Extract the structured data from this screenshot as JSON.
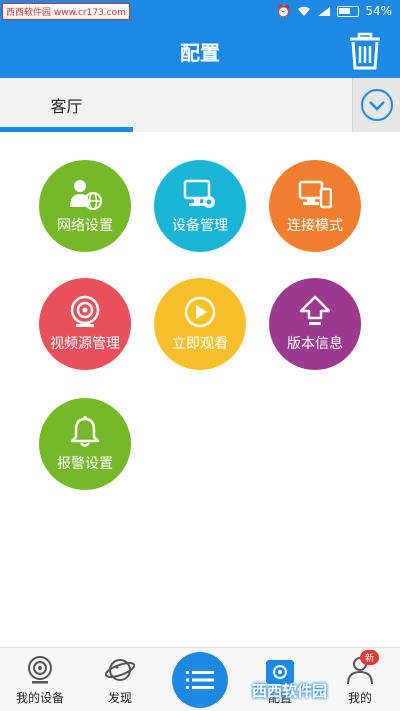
{
  "status_bar": {
    "watermark": "西西软件园 www.cr173.com",
    "battery": "54%"
  },
  "app_bar": {
    "title": "配置"
  },
  "tabs": [
    {
      "label": "客厅",
      "selected": true
    }
  ],
  "tiles": [
    {
      "label": "网络设置",
      "color": "#76b82a",
      "icon": "network-settings-icon"
    },
    {
      "label": "设备管理",
      "color": "#1ab5d5",
      "icon": "device-management-icon"
    },
    {
      "label": "连接模式",
      "color": "#f08030",
      "icon": "connection-mode-icon"
    },
    {
      "label": "视频源管理",
      "color": "#e8505b",
      "icon": "video-source-icon"
    },
    {
      "label": "立即观看",
      "color": "#f5c02c",
      "icon": "play-icon"
    },
    {
      "label": "版本信息",
      "color": "#9b3a8e",
      "icon": "upload-arrow-icon"
    },
    {
      "label": "报警设置",
      "color": "#76b82a",
      "icon": "bell-icon"
    }
  ],
  "bottom_nav": {
    "items": [
      {
        "label": "我的设备",
        "icon": "camera-icon"
      },
      {
        "label": "发现",
        "icon": "planet-icon"
      },
      {
        "label": "配置",
        "icon": "gear-icon",
        "selected": true
      },
      {
        "label": "我的",
        "icon": "person-icon"
      }
    ],
    "badge": "新",
    "center_icon": "list-icon"
  },
  "watermark_logo": "西西软件园",
  "colors": {
    "primary": "#1e88e5"
  }
}
